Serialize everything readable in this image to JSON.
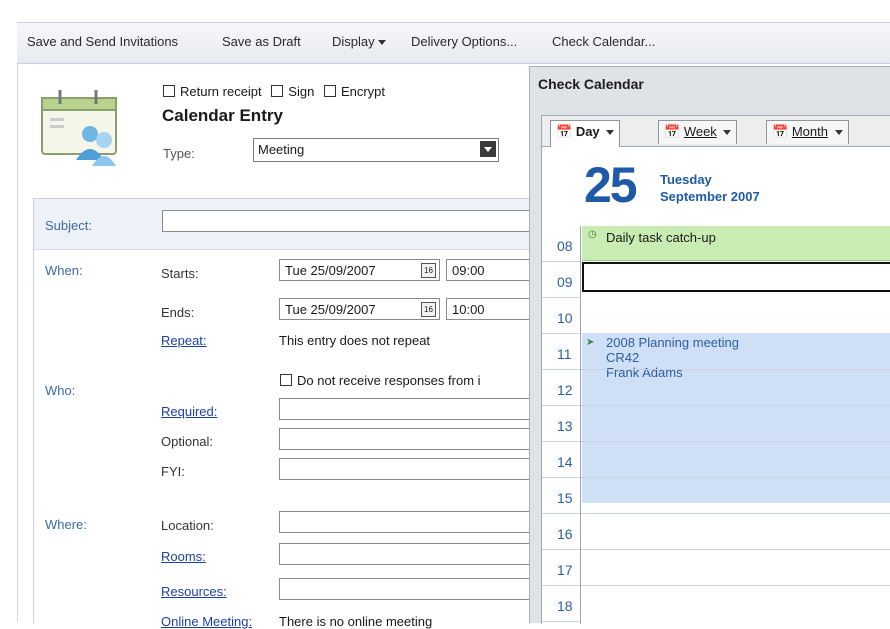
{
  "toolbar": {
    "save_send": "Save and Send Invitations",
    "save_draft": "Save as Draft",
    "display": "Display",
    "delivery": "Delivery Options...",
    "check_calendar": "Check Calendar..."
  },
  "header": {
    "return_receipt": "Return receipt",
    "sign": "Sign",
    "encrypt": "Encrypt",
    "title": "Calendar Entry",
    "type_label": "Type:",
    "type_value": "Meeting"
  },
  "form": {
    "subject_label": "Subject:",
    "when_label": "When:",
    "starts_label": "Starts:",
    "start_date": "Tue 25/09/2007",
    "start_time": "09:00",
    "ends_label": "Ends:",
    "end_date": "Tue 25/09/2007",
    "end_time": "10:00",
    "repeat_link": "Repeat:",
    "repeat_text": "This entry does not repeat",
    "who_label": "Who:",
    "no_responses": "Do not receive responses from i",
    "required_link": "Required:",
    "optional_label": "Optional:",
    "fyi_label": "FYI:",
    "where_label": "Where:",
    "location_label": "Location:",
    "rooms_link": "Rooms:",
    "resources_link": "Resources:",
    "online_link": "Online Meeting:",
    "online_text": "There is no online meeting"
  },
  "calendar_panel": {
    "title": "Check Calendar",
    "tabs": {
      "day": "Day",
      "week": "Week",
      "month": "Month"
    },
    "date_number": "25",
    "weekday": "Tuesday",
    "month_year": "September 2007",
    "hours": [
      "08",
      "09",
      "10",
      "11",
      "12",
      "13",
      "14",
      "15",
      "16",
      "17",
      "18"
    ],
    "events": [
      {
        "title": "Daily task catch-up"
      },
      {
        "title": "2008 Planning meeting",
        "room": "CR42",
        "person": "Frank Adams"
      }
    ]
  },
  "colors": {
    "accent_blue": "#1f5aa6",
    "event_green": "#c9ecb2",
    "event_blue": "#cfe0f6"
  }
}
